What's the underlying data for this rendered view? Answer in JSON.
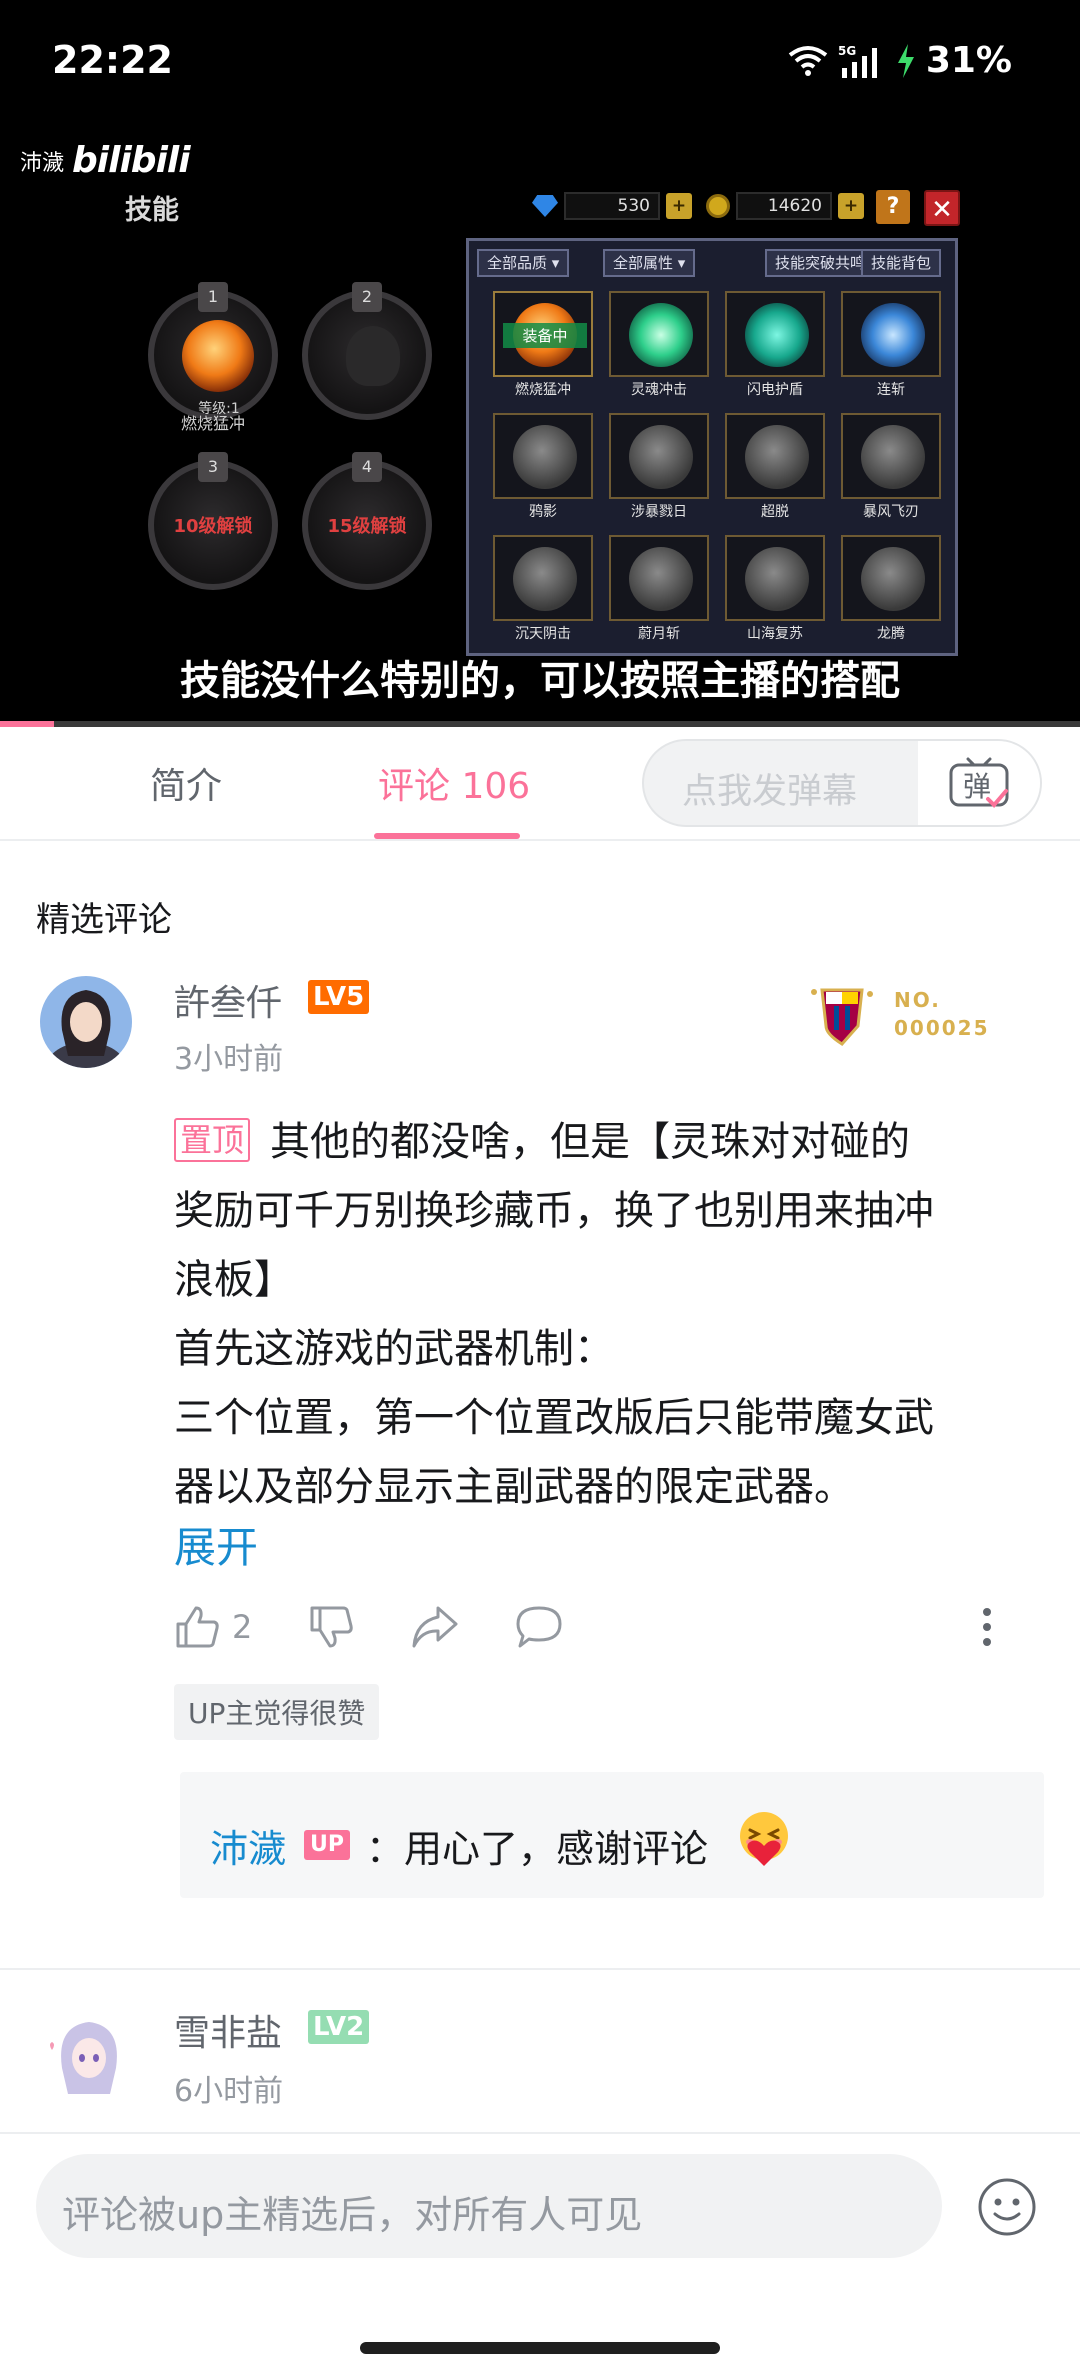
{
  "status_bar": {
    "time": "22:22",
    "network": "5G",
    "battery": "31%"
  },
  "video": {
    "uploader_watermark": "沛濊",
    "platform_logo": "bilibili",
    "subtitle": "技能没什么特别的，可以按照主播的搭配",
    "progress_fraction": 0.05,
    "game": {
      "title": "技能",
      "gems": "530",
      "coins": "14620",
      "help": "?",
      "close": "✕",
      "slots": [
        {
          "num": "1",
          "level": "等级:1",
          "name": "燃烧猛冲"
        },
        {
          "num": "2"
        },
        {
          "num": "3",
          "lock": "10级解锁"
        },
        {
          "num": "4",
          "lock": "15级解锁"
        }
      ],
      "filters": {
        "quality": "全部品质 ▾",
        "attribute": "全部属性 ▾",
        "breakthrough": "技能突破共鸣",
        "bag": "技能背包"
      },
      "equipped_tag": "装备中",
      "skills": [
        {
          "name": "燃烧猛冲",
          "art": "fire",
          "equipped": true
        },
        {
          "name": "灵魂冲击",
          "art": "green"
        },
        {
          "name": "闪电护盾",
          "art": "teal"
        },
        {
          "name": "连斩",
          "art": "blue"
        },
        {
          "name": "鸦影",
          "art": "grey"
        },
        {
          "name": "涉暴戮日",
          "art": "grey"
        },
        {
          "name": "超脱",
          "art": "grey"
        },
        {
          "name": "暴风飞刃",
          "art": "grey"
        },
        {
          "name": "沉天阴击",
          "art": "grey"
        },
        {
          "name": "蔚月斩",
          "art": "grey"
        },
        {
          "name": "山海复苏",
          "art": "grey"
        },
        {
          "name": "龙腾",
          "art": "grey"
        }
      ]
    }
  },
  "tabs": {
    "intro": "简介",
    "comments": "评论 106",
    "danmu_placeholder": "点我发弹幕",
    "danmu_button": "弹"
  },
  "section_title": "精选评论",
  "comments": [
    {
      "username": "許叁仟",
      "level": "LV5",
      "time": "3小时前",
      "fan_badge_no": "NO.",
      "fan_badge_num": "000025",
      "pinned_tag": "置顶",
      "text_lines": [
        "其他的都没啥，但是【灵珠对对碰的",
        "奖励可千万别换珍藏币，换了也别用来抽冲",
        "浪板】",
        "首先这游戏的武器机制：",
        "三个位置，第一个位置改版后只能带魔女武",
        "器以及部分显示主副武器的限定武器。"
      ],
      "expand": "展开",
      "likes": "2",
      "up_tag": "UP主觉得很赞",
      "reply": {
        "user": "沛濊",
        "badge": "UP",
        "text": "：用心了，感谢评论"
      }
    },
    {
      "username": "雪非盐",
      "level": "LV2",
      "time": "6小时前"
    }
  ],
  "input_placeholder": "评论被up主精选后，对所有人可见",
  "colors": {
    "accent_pink": "#fb7299",
    "link_blue": "#178bcf",
    "level5": "#ff6c00",
    "level2": "#95ddb2"
  }
}
